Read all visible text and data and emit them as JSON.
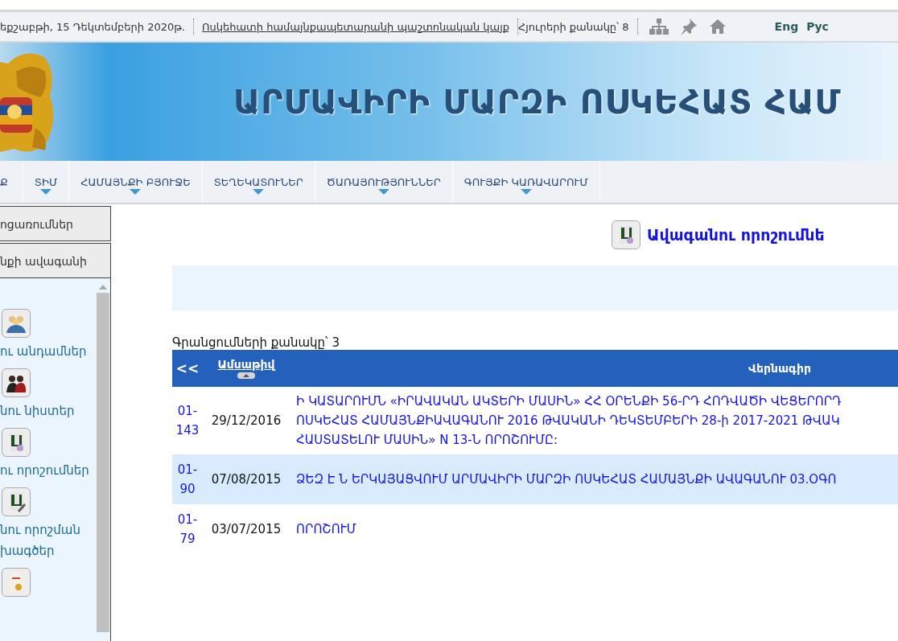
{
  "top_bar": {
    "date": "եքշաբթի, 15 Դեկտեմբերի 2020թ.",
    "site_link": "Ոսկեհատի համայնքապետարանի պաշտոնական կայք",
    "visitors": "Հյուրերի քանակը՝ 8",
    "languages": [
      "Eng",
      "Рус"
    ]
  },
  "banner": {
    "title": "ԱՐՄԱՎԻՐԻ ՄԱՐԶԻ ՈՍԿԵՀԱՏ ՀԱՄ"
  },
  "nav": [
    {
      "label": "Ք",
      "has_menu": false
    },
    {
      "label": "ՏԻՄ",
      "has_menu": true
    },
    {
      "label": "ՀԱՄԱՅՆՔԻ ԲՅՈՒՋԵ",
      "has_menu": true
    },
    {
      "label": "ՏԵՂԵԿԱՏՈՒՆԵՐ",
      "has_menu": true
    },
    {
      "label": "ԾԱՌԱՅՈՒԹՅՈՒՆՆԵՐ",
      "has_menu": true
    },
    {
      "label": "ԳՈՒՅՔԻ ԿԱՌԱՎԱՐՈՒՄ",
      "has_menu": true
    }
  ],
  "sidebar": {
    "sections": [
      "ոցառումներ",
      "նքի ավագանի"
    ],
    "items": [
      {
        "kind": "members",
        "lines": [
          "ու անդամներ"
        ]
      },
      {
        "kind": "meetings",
        "lines": [
          "նու նիստեր"
        ]
      },
      {
        "kind": "decisions",
        "lines": [
          "ու որոշումներ"
        ]
      },
      {
        "kind": "drafts",
        "lines": [
          "նու որոշման",
          "խագծեր"
        ]
      },
      {
        "kind": "certificate"
      }
    ]
  },
  "heading": "Ավագանու որոշումնե",
  "count": "Գրանցումների քանակը՝ 3",
  "table": {
    "columns": [
      "<<",
      "Ամսաթիվ",
      "Վերնագիր"
    ],
    "rows": [
      {
        "number": "01-143",
        "date": "29/12/2016",
        "title": [
          "Ի ԿԱՏԱՐՈՒՄՆ «ԻՐԱՎԱԿԱՆ ԱԿՏԵՐԻ ՄԱՍԻՆ» ՀՀ ՕՐԵՆՔԻ 56-ՐԴ ՀՈԴՎԱԾԻ ՎԵՑԵՐՈՐԴ",
          "ՈՍԿԵՀԱՏ ՀԱՄԱՅՆՔԻԱՎԱԳԱՆՈՒ 2016 ԹՎԱԿԱՆԻ ԴԵԿՏԵՄԲԵՐԻ 28-ի 2017-2021 ԹՎԱԿ",
          "ՀԱՍՏԱՏԵԼՈՒ ՄԱՍԻՆ» N 13-Ն ՈՐՈՇՈՒՄԸ:"
        ]
      },
      {
        "number": "01-90",
        "date": "07/08/2015",
        "title": [
          "ՁԵԶ Է Ն ԵՐԿԱՅԱՑՎՈՒՄ ԱՐՄԱՎԻՐԻ ՄԱՐԶԻ ՈՍԿԵՀԱՏ ՀԱՄԱՅՆՔԻ ԱՎԱԳԱՆՈՒ 03.ՕԳՈ"
        ]
      },
      {
        "number": "01-79",
        "date": "03/07/2015",
        "title": [
          "ՈՐՈՇՈՒՄ"
        ]
      }
    ]
  }
}
